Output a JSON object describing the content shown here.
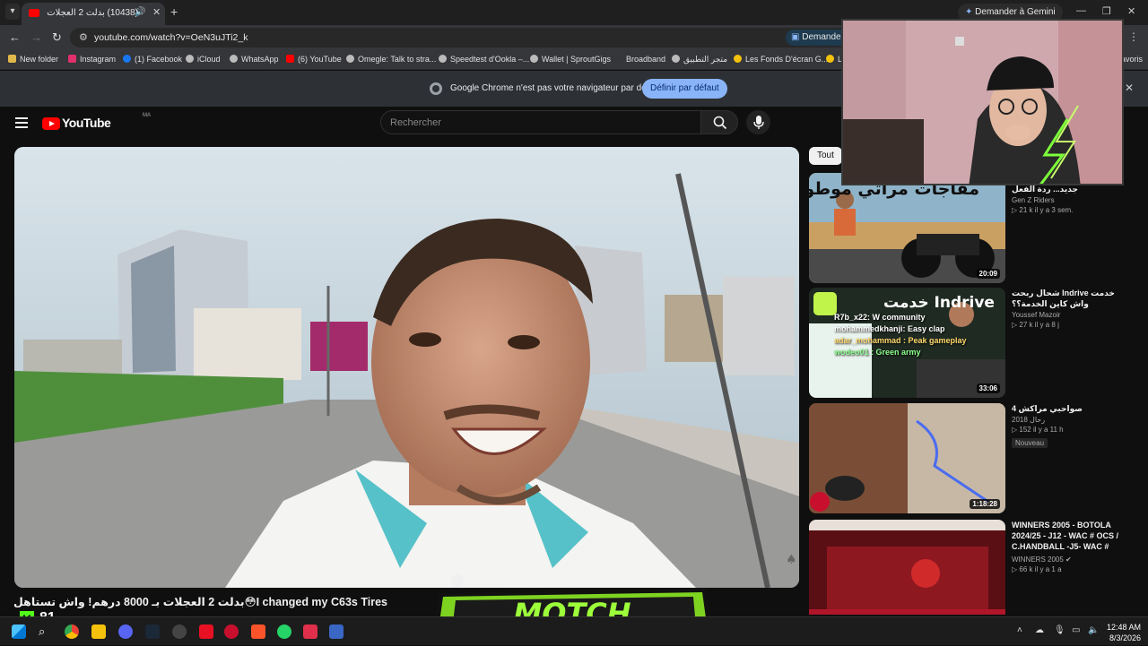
{
  "browser": {
    "tab_title": "(10438) بدلت 2 العجلات بـ 0",
    "tab_menu_icon": "chevron-down-icon",
    "new_tab_label": "+",
    "gemini_button": "Demander à Gemini",
    "url": "youtube.com/watch?v=OeN3uJTi2_k",
    "ask_button": "Demander",
    "bookmarks": [
      {
        "label": "New folder",
        "color": "#e0b94a"
      },
      {
        "label": "Instagram",
        "color": "#e1306c"
      },
      {
        "label": "(1) Facebook",
        "color": "#1877f2"
      },
      {
        "label": "iCloud",
        "color": "#bbbbbb"
      },
      {
        "label": "WhatsApp",
        "color": "#bbbbbb"
      },
      {
        "label": "(6) YouTube",
        "color": "#ff0000"
      },
      {
        "label": "Omegle: Talk to stra...",
        "color": "#bbbbbb"
      },
      {
        "label": "Speedtest d'Ookla –...",
        "color": "#bbbbbb"
      },
      {
        "label": "Wallet | SproutGigs",
        "color": "#bbbbbb"
      },
      {
        "label": "Broadband",
        "color": "#35363a"
      },
      {
        "label": "متجر التطبيق",
        "color": "#bbbbbb"
      },
      {
        "label": "Les Fonds D'écran G...",
        "color": "#f4c20d"
      },
      {
        "label": "Le",
        "color": "#f4c20d"
      },
      {
        "label": "avoris",
        "color": "#35363a"
      }
    ]
  },
  "infobar": {
    "message": "Google Chrome n'est pas votre navigateur par défaut",
    "button": "Définir par défaut"
  },
  "youtube": {
    "logo": "YouTube",
    "country": "MA",
    "search_placeholder": "Rechercher",
    "video_title": "بدلت 2 العجلات بـ 8000 درهم! واش تستاهل😳I changed my C63s Tires",
    "chip_all": "Tout",
    "recommendations": [
      {
        "title": "ضريب ماراتي بوطوري جديد... ردة الفعل",
        "channel": "Gen Z Riders",
        "meta": "▷ 21 k  il y a 3 sem.",
        "duration": "20:09",
        "badge": ""
      },
      {
        "title": "خدمت Indrive شحال ربحت واش كاين الخدمة؟؟",
        "channel": "Youssef Mazoir",
        "meta": "▷ 27 k  il y a 8 j",
        "duration": "33:06",
        "badge": ""
      },
      {
        "title": "صواحبي مراكش 4",
        "channel": "رحال 2018",
        "meta": "▷ 152  il y a 11 h",
        "duration": "1:18:28",
        "badge": "Nouveau"
      },
      {
        "title": "WINNERS 2005 - BOTOLA 2024/25 - J12 - WAC # OCS / C.HANDBALL -J5- WAC # A...",
        "channel": "WINNERS 2005 ✔",
        "meta": "▷ 66 k  il y a 1 a",
        "duration": "",
        "badge": ""
      }
    ]
  },
  "thumb1_text": "مفاجآت مراتي موطور جديد",
  "thumb2_text": "خدمت Indrive",
  "chat_lines": [
    "R7b_x22: W community",
    "mohammedkhanji: Easy clap",
    "adar_mohammad : Peak gameplay",
    "wodeo01 : Green army"
  ],
  "overlay": {
    "motch_text": "MOTCH",
    "kick_count": "81"
  },
  "taskbar": {
    "time": "12:48 AM",
    "date": "8/3/2026"
  }
}
